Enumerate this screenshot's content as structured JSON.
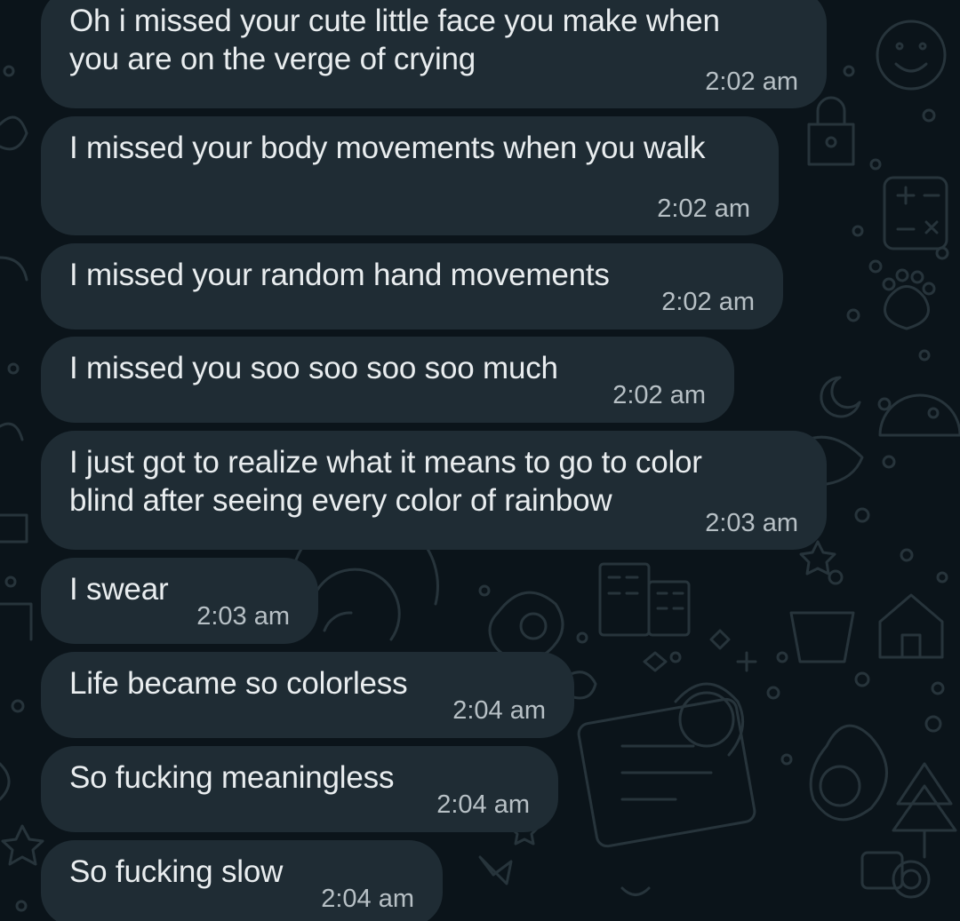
{
  "chat": {
    "messages": [
      {
        "text": "Oh i missed your cute little face you make when you are on the verge of crying",
        "time": "2:02 am"
      },
      {
        "text": "I missed your body movements when you walk",
        "time": "2:02 am"
      },
      {
        "text": "I missed your random hand movements",
        "time": "2:02 am"
      },
      {
        "text": "I missed you soo soo soo soo much",
        "time": "2:02 am"
      },
      {
        "text": "I just got to realize what it means to go to color blind after seeing every color of rainbow",
        "time": "2:03 am"
      },
      {
        "text": "I swear",
        "time": "2:03 am"
      },
      {
        "text": "Life became so colorless",
        "time": "2:04 am"
      },
      {
        "text": "So fucking meaningless",
        "time": "2:04 am"
      },
      {
        "text": "So fucking slow",
        "time": "2:04 am"
      }
    ]
  },
  "theme": {
    "background": "#0b141a",
    "bubble": "#1f2c34",
    "text": "#e9edef",
    "time_text": "#b7c0c5",
    "doodle": "#27343b"
  },
  "wallpaper": {
    "style": "doodle-pattern"
  }
}
